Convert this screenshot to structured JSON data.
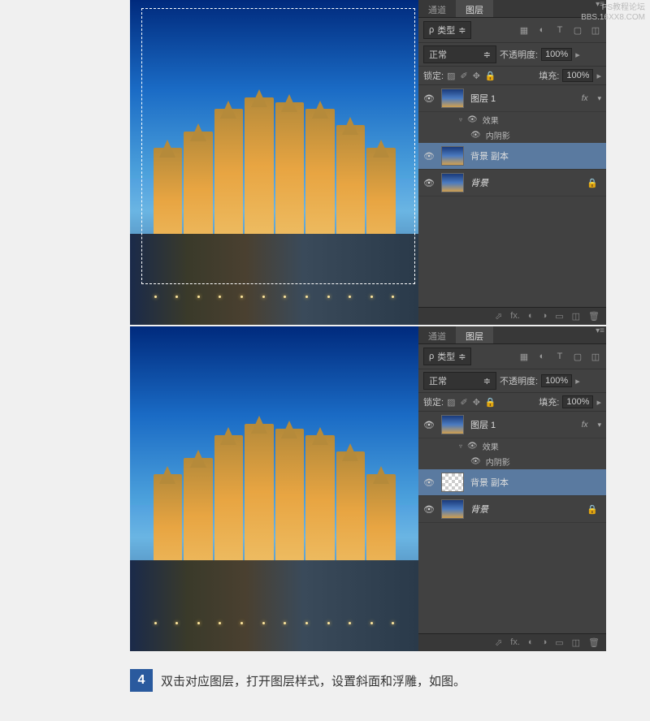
{
  "watermark": {
    "line1": "PS教程论坛",
    "line2": "BBS.16XX8.COM"
  },
  "panel": {
    "tabs": {
      "channels": "通道",
      "layers": "图层"
    },
    "filter_label": "类型",
    "blend_mode": "正常",
    "opacity_label": "不透明度:",
    "opacity_value": "100%",
    "lock_label": "锁定:",
    "fill_label": "填充:",
    "fill_value": "100%",
    "layers_top": [
      {
        "name": "图层 1",
        "fx": "fx"
      },
      {
        "name": "背景 副本"
      },
      {
        "name": "背景"
      }
    ],
    "effects_label": "效果",
    "inner_shadow": "内阴影",
    "bottom_icons": {
      "link": "⬭",
      "fx": "fx.",
      "mask": "◐",
      "adjust": "◑",
      "group": "▭",
      "new": "▫",
      "trash": "🗑"
    }
  },
  "step": {
    "num": "4",
    "text": "双击对应图层，打开图层样式，设置斜面和浮雕，如图。"
  }
}
